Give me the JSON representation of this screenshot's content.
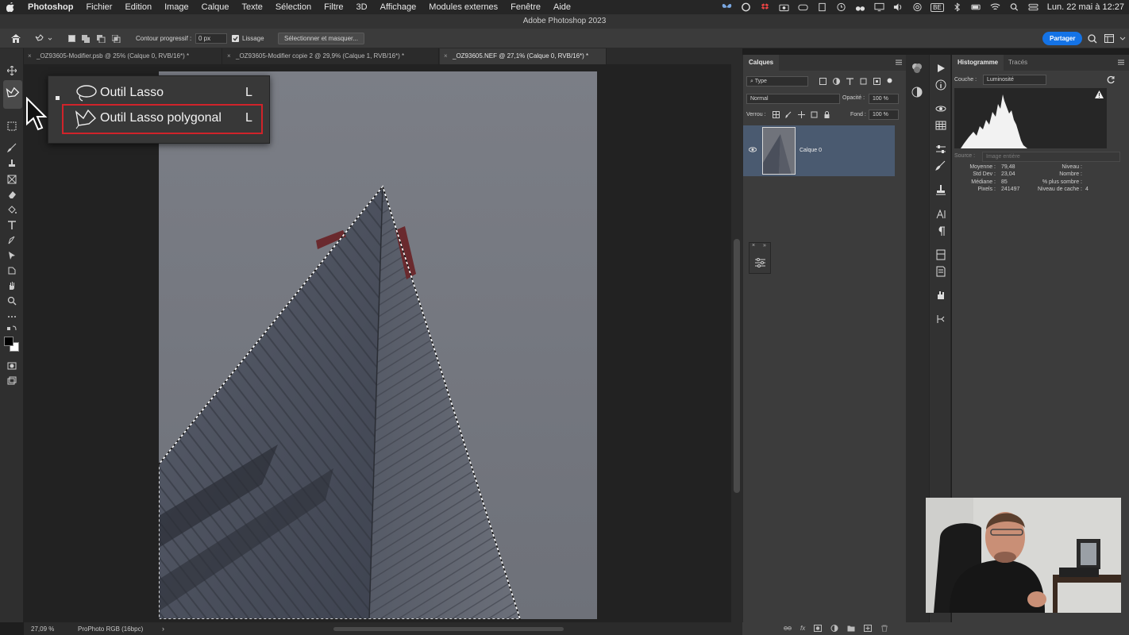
{
  "menubar": {
    "app_name": "Photoshop",
    "items": [
      "Fichier",
      "Edition",
      "Image",
      "Calque",
      "Texte",
      "Sélection",
      "Filtre",
      "3D",
      "Affichage",
      "Modules externes",
      "Fenêtre",
      "Aide"
    ],
    "keyboard_layout": "BE",
    "datetime": "Lun. 22 mai à 12:27"
  },
  "window": {
    "title": "Adobe Photoshop 2023"
  },
  "options": {
    "feather_label": "Contour progressif :",
    "feather_value": "0 px",
    "smoothing_label": "Lissage",
    "smoothing_checked": true,
    "select_mask_label": "Sélectionner et masquer...",
    "share_label": "Partager"
  },
  "tabs": [
    {
      "label": "_OZ93605-Modifier.psb @ 25% (Calque 0, RVB/16*) *",
      "active": false
    },
    {
      "label": "_OZ93605-Modifier copie 2 @ 29,9% (Calque 1, RVB/16*) *",
      "active": false
    },
    {
      "label": "_OZ93605.NEF @ 27,1% (Calque 0, RVB/16*) *",
      "active": true
    }
  ],
  "flyout": {
    "items": [
      {
        "label": "Outil Lasso",
        "shortcut": "L",
        "icon": "lasso-icon"
      },
      {
        "label": "Outil Lasso polygonal",
        "shortcut": "L",
        "icon": "polygonal-lasso-icon",
        "selected": true
      }
    ]
  },
  "layers_panel": {
    "tab": "Calques",
    "filter": "Type",
    "blend_mode": "Normal",
    "opacity_label": "Opacité :",
    "opacity_value": "100 %",
    "lock_label": "Verrou :",
    "fill_label": "Fond :",
    "fill_value": "100 %",
    "layers": [
      {
        "name": "Calque 0",
        "visible": true
      }
    ]
  },
  "histogram_panel": {
    "tabs": [
      "Histogramme",
      "Tracés"
    ],
    "channel_label": "Couche :",
    "channel_value": "Luminosité",
    "source_label": "Source :",
    "source_value": "Image entière",
    "stats_left": [
      {
        "label": "Moyenne :",
        "value": "79,48"
      },
      {
        "label": "Std Dev :",
        "value": "23,04"
      },
      {
        "label": "Médiane :",
        "value": "85"
      },
      {
        "label": "Pixels :",
        "value": "241497"
      }
    ],
    "stats_right": [
      {
        "label": "Niveau :",
        "value": ""
      },
      {
        "label": "Nombre :",
        "value": ""
      },
      {
        "label": "% plus sombre :",
        "value": ""
      },
      {
        "label": "Niveau de cache :",
        "value": "4"
      }
    ]
  },
  "status": {
    "zoom": "27,09 %",
    "profile": "ProPhoto RGB (16bpc)"
  },
  "colors": {
    "accent_blue": "#1473e6",
    "highlight_red": "#d0232a",
    "layer_selected": "#4a5a70",
    "panel_bg": "#3c3c3c",
    "sky": "#74787f"
  }
}
